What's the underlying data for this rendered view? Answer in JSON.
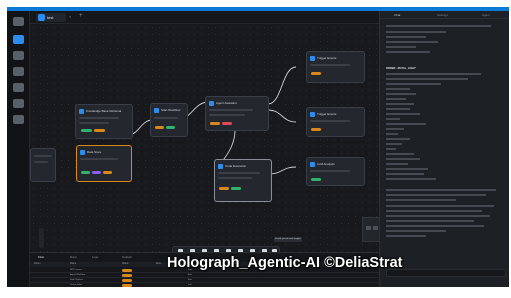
{
  "app": {
    "tab_label": "test",
    "tab_close": "×",
    "tab_add": "+"
  },
  "left_nav": [
    "Home",
    "Workflows",
    "Agents",
    "Tools",
    "Graph",
    "Settings",
    "Apps"
  ],
  "nodes": [
    {
      "title": "Knowledge Base Retrieval"
    },
    {
      "title": "Start Workflow"
    },
    {
      "title": "Agent Assistant"
    },
    {
      "title": "Trigger Events"
    },
    {
      "title": "Trigger Events"
    },
    {
      "title": "Code Execution"
    },
    {
      "title": "LLM Analysis"
    },
    {
      "title": "Data Store"
    },
    {
      "title": "Output"
    }
  ],
  "toolbar": [
    "Undo",
    "Redo",
    "Add",
    "Save",
    "Run",
    "Debug",
    "Versions",
    "Export",
    "Share"
  ],
  "tooltip": "Enable pinned mode (toggle)",
  "panel": {
    "tabs": [
      "Chat",
      "Settings",
      "Agent"
    ],
    "heading": "ORDER - ROYAL_LIGHT"
  },
  "bottom": {
    "tabs": [
      "Flow",
      "Runs",
      "Logs",
      "Outputs"
    ],
    "columns": [
      "Action",
      "Name",
      "Status",
      "Runs",
      "Type",
      "Updated"
    ],
    "rows": [
      {
        "name": "MCP server",
        "status": "",
        "type": "tool"
      },
      {
        "name": "Agent Workflow",
        "status": "",
        "type": "flow"
      },
      {
        "name": "Data Pipeline",
        "status": "",
        "type": "flow"
      },
      {
        "name": "Vector Index",
        "status": "",
        "type": "tool"
      }
    ]
  },
  "watermark": "Holograph_Agentic-AI ©DeliaStrat",
  "colors": {
    "accent": "#2c8df0",
    "warning": "#d78a1a",
    "success": "#2fb36d",
    "danger": "#e2475a",
    "topbar": "#0e7ad8"
  }
}
